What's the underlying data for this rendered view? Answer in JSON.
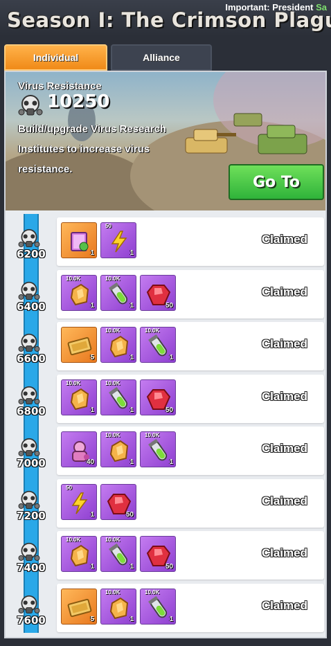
{
  "header": {
    "marquee_prefix": "Important: President ",
    "marquee_highlight": "Sa",
    "season_title": "Season I: The Crimson Plague"
  },
  "tabs": [
    {
      "label": "Individual",
      "active": true
    },
    {
      "label": "Alliance",
      "active": false
    }
  ],
  "banner": {
    "resistance_label": "Virus Resistance",
    "resistance_value": "10250",
    "description": "Build/upgrade Virus Research Institutes to increase virus resistance.",
    "goto_label": "Go To"
  },
  "colors": {
    "accent_orange": "#f08a18",
    "goto_green": "#2fb33a",
    "progress_blue": "#2aa8e8",
    "epic_purple": "#8e3fd0",
    "ruby_red": "#d8283a"
  },
  "tiers": [
    {
      "threshold": "6200",
      "status": "Claimed",
      "rewards": [
        {
          "icon": "skill-book-icon",
          "rarity": "orange",
          "qty": "1",
          "badge": ""
        },
        {
          "icon": "energy-bolt-icon",
          "rarity": "purple",
          "qty": "1",
          "badge": "50"
        }
      ]
    },
    {
      "threshold": "6400",
      "status": "Claimed",
      "rewards": [
        {
          "icon": "ore-chunk-icon",
          "rarity": "purple",
          "qty": "1",
          "badge": "10.0K"
        },
        {
          "icon": "serum-vial-icon",
          "rarity": "purple",
          "qty": "1",
          "badge": "10.0K"
        },
        {
          "icon": "ruby-gem-icon",
          "rarity": "purple",
          "qty": "50",
          "badge": ""
        }
      ]
    },
    {
      "threshold": "6600",
      "status": "Claimed",
      "rewards": [
        {
          "icon": "gold-ticket-icon",
          "rarity": "orange",
          "qty": "5",
          "badge": ""
        },
        {
          "icon": "ore-chunk-icon",
          "rarity": "purple",
          "qty": "1",
          "badge": "10.0K"
        },
        {
          "icon": "serum-vial-icon",
          "rarity": "purple",
          "qty": "1",
          "badge": "10.0K"
        }
      ]
    },
    {
      "threshold": "6800",
      "status": "Claimed",
      "rewards": [
        {
          "icon": "ore-chunk-icon",
          "rarity": "purple",
          "qty": "1",
          "badge": "10.0K"
        },
        {
          "icon": "serum-vial-icon",
          "rarity": "purple",
          "qty": "1",
          "badge": "10.0K"
        },
        {
          "icon": "ruby-gem-icon",
          "rarity": "purple",
          "qty": "50",
          "badge": ""
        }
      ]
    },
    {
      "threshold": "7000",
      "status": "Claimed",
      "rewards": [
        {
          "icon": "hero-shard-icon",
          "rarity": "purple",
          "qty": "40",
          "badge": ""
        },
        {
          "icon": "ore-chunk-icon",
          "rarity": "purple",
          "qty": "1",
          "badge": "10.0K"
        },
        {
          "icon": "serum-vial-icon",
          "rarity": "purple",
          "qty": "1",
          "badge": "10.0K"
        }
      ]
    },
    {
      "threshold": "7200",
      "status": "Claimed",
      "rewards": [
        {
          "icon": "energy-bolt-icon",
          "rarity": "purple",
          "qty": "1",
          "badge": "50"
        },
        {
          "icon": "ruby-gem-icon",
          "rarity": "purple",
          "qty": "50",
          "badge": ""
        }
      ]
    },
    {
      "threshold": "7400",
      "status": "Claimed",
      "rewards": [
        {
          "icon": "ore-chunk-icon",
          "rarity": "purple",
          "qty": "1",
          "badge": "10.0K"
        },
        {
          "icon": "serum-vial-icon",
          "rarity": "purple",
          "qty": "1",
          "badge": "10.0K"
        },
        {
          "icon": "ruby-gem-icon",
          "rarity": "purple",
          "qty": "50",
          "badge": ""
        }
      ]
    },
    {
      "threshold": "7600",
      "status": "Claimed",
      "rewards": [
        {
          "icon": "gold-ticket-icon",
          "rarity": "orange",
          "qty": "5",
          "badge": ""
        },
        {
          "icon": "ore-chunk-icon",
          "rarity": "purple",
          "qty": "1",
          "badge": "10.0K"
        },
        {
          "icon": "serum-vial-icon",
          "rarity": "purple",
          "qty": "1",
          "badge": "10.0K"
        }
      ]
    }
  ]
}
